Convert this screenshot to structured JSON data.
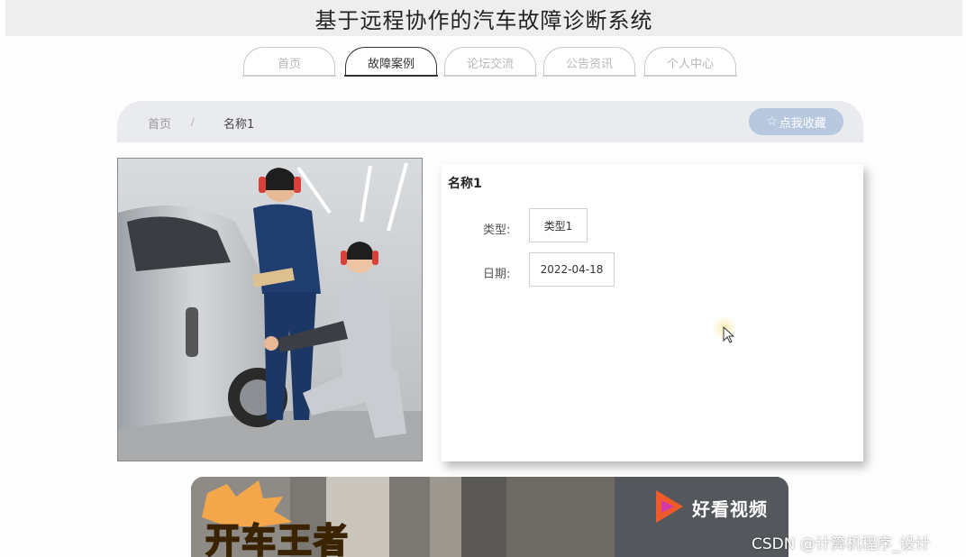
{
  "site": {
    "title": "基于远程协作的汽车故障诊断系统"
  },
  "nav": {
    "items": [
      {
        "label": "首页",
        "active": false
      },
      {
        "label": "故障案例",
        "active": true
      },
      {
        "label": "论坛交流",
        "active": false
      },
      {
        "label": "公告资讯",
        "active": false
      },
      {
        "label": "个人中心",
        "active": false
      }
    ]
  },
  "breadcrumb": {
    "home": "首页",
    "separator": "/",
    "current": "名称1"
  },
  "favorite_button": {
    "icon": "star-icon",
    "label": "点我收藏"
  },
  "detail": {
    "name": "名称1",
    "fields": [
      {
        "label": "类型:",
        "value": "类型1"
      },
      {
        "label": "日期:",
        "value": "2022-04-18"
      }
    ]
  },
  "video_banner": {
    "caption": "开车王者",
    "brand": "好看视频",
    "brand_icon": "play-logo-icon"
  },
  "watermark": "CSDN @计算机程序_设计",
  "colors": {
    "title_bar": "#eeeeef",
    "nav_active": "#333333",
    "nav_inactive": "#b8b8b8",
    "breadcrumb_bar": "#e9ebee",
    "favorite_button": "#b7c8df"
  }
}
